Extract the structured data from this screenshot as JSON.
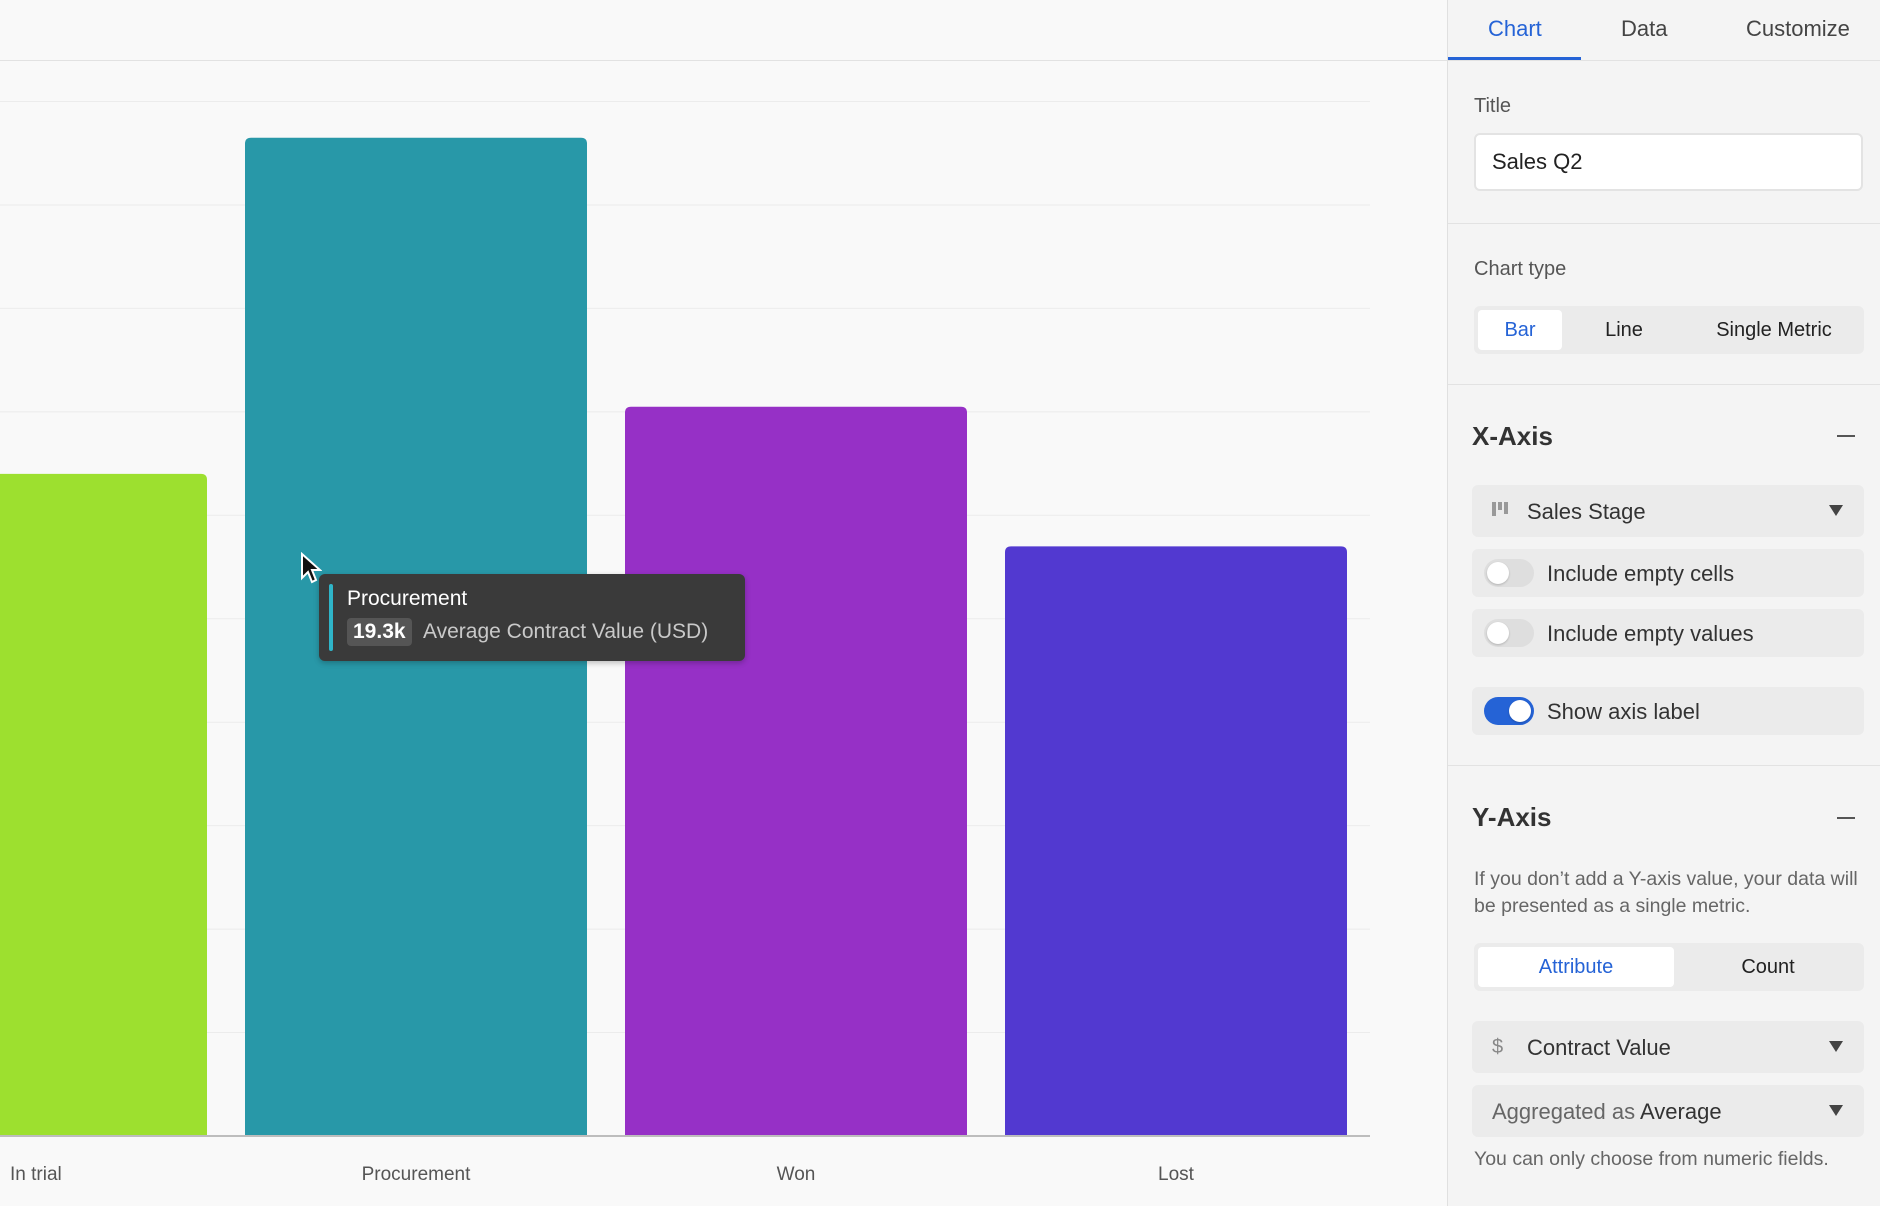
{
  "chart_data": {
    "type": "bar",
    "categories": [
      "In trial",
      "Procurement",
      "Won",
      "Lost"
    ],
    "values": [
      12.8,
      19.3,
      14.1,
      11.4
    ],
    "colors": [
      "#9de02f",
      "#2898a8",
      "#9630c6",
      "#5239d0"
    ],
    "ylim": [
      0,
      20.3
    ],
    "grid": true,
    "ylabel": "Average Contract Value (USD)"
  },
  "tooltip": {
    "title": "Procurement",
    "value": "19.3k",
    "label": "Average Contract Value (USD)",
    "accent": "#2fb5c9"
  },
  "sidebar": {
    "tabs": [
      "Chart",
      "Data",
      "Customize"
    ],
    "active_tab": "Chart",
    "title_label": "Title",
    "title_value": "Sales Q2",
    "chart_type_label": "Chart type",
    "chart_types": [
      "Bar",
      "Line",
      "Single Metric"
    ],
    "active_chart_type": "Bar",
    "x_axis": {
      "heading": "X-Axis",
      "field": "Sales Stage",
      "field_icon": "bar-chart-icon",
      "include_empty_cells": {
        "label": "Include empty cells",
        "on": false
      },
      "include_empty_values": {
        "label": "Include empty values",
        "on": false
      },
      "show_axis_label": {
        "label": "Show axis label",
        "on": true
      }
    },
    "y_axis": {
      "heading": "Y-Axis",
      "help": "If you don’t add a Y-axis value, your data will be presented as a single metric.",
      "modes": [
        "Attribute",
        "Count"
      ],
      "active_mode": "Attribute",
      "field": "Contract Value",
      "field_icon": "$",
      "aggregation_prefix": "Aggregated as",
      "aggregation": "Average",
      "note": "You can only choose from numeric fields."
    },
    "accent": "#2563d6"
  }
}
